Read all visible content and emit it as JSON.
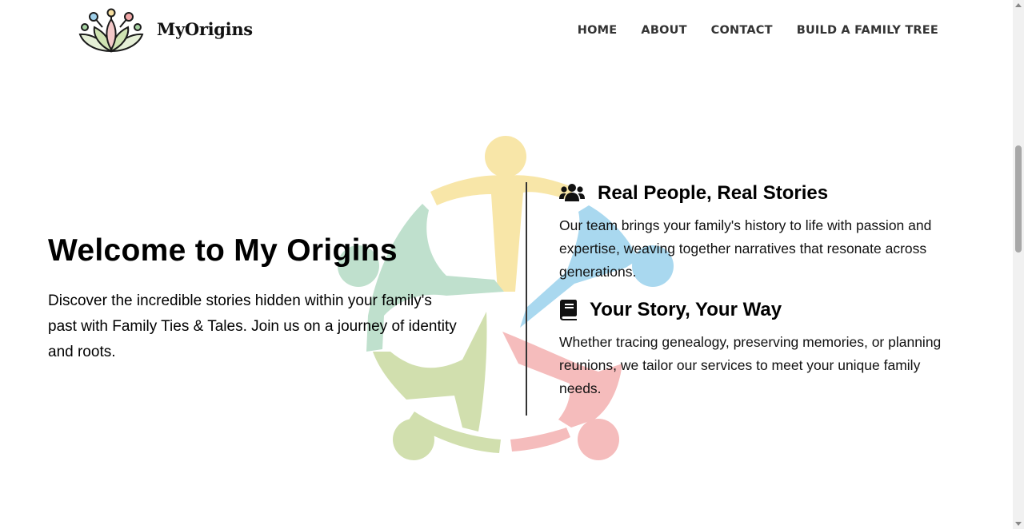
{
  "header": {
    "brand": "MyOrigins",
    "nav": [
      {
        "label": "HOME"
      },
      {
        "label": "ABOUT"
      },
      {
        "label": "CONTACT"
      },
      {
        "label": "BUILD A FAMILY TREE"
      }
    ]
  },
  "hero": {
    "title": "Welcome to My Origins",
    "text": "Discover the incredible stories hidden within your family's past with Family Ties & Tales. Join us on a journey of identity and roots."
  },
  "features": [
    {
      "icon": "users-icon",
      "title": "Real People, Real Stories",
      "text": "Our team brings your family's history to life with passion and expertise, weaving together narratives that resonate across generations."
    },
    {
      "icon": "book-icon",
      "title": "Your Story, Your Way",
      "text": "Whether tracing genealogy, preserving memories, or planning reunions, we tailor our services to meet your unique family needs."
    }
  ],
  "colors": {
    "yellow": "#f8e6a8",
    "blue": "#a9d8ef",
    "pink": "#f5bcbc",
    "green": "#d1dfae",
    "mint": "#bfe0cd"
  }
}
